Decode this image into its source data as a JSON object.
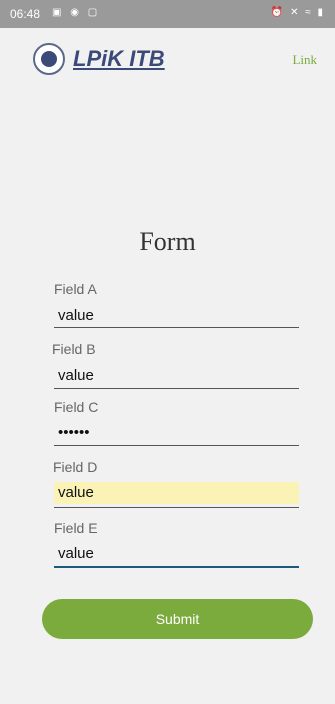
{
  "status_bar": {
    "time": "06:48",
    "left_icons": [
      "image-icon",
      "message-icon",
      "notification-icon"
    ],
    "right_icons": [
      "alarm-icon",
      "mute-icon",
      "wifi-icon",
      "signal-icon",
      "battery-icon"
    ]
  },
  "header": {
    "logo_text": "LPiK ITB",
    "top_link": "Link"
  },
  "heading": "Form",
  "fields": [
    {
      "label": "Field A",
      "value": "value"
    },
    {
      "label": "Field B",
      "value": "value"
    },
    {
      "label": "Field C",
      "value": "••••••"
    },
    {
      "label": "Field D",
      "value": "value"
    },
    {
      "label": "Field E",
      "value": "value"
    }
  ],
  "submit_label": "Submit",
  "colors": {
    "accent": "#7aab3c",
    "logo": "#3b4a78",
    "autofill": "#fbf3b5",
    "focus": "#1a5a7a"
  }
}
